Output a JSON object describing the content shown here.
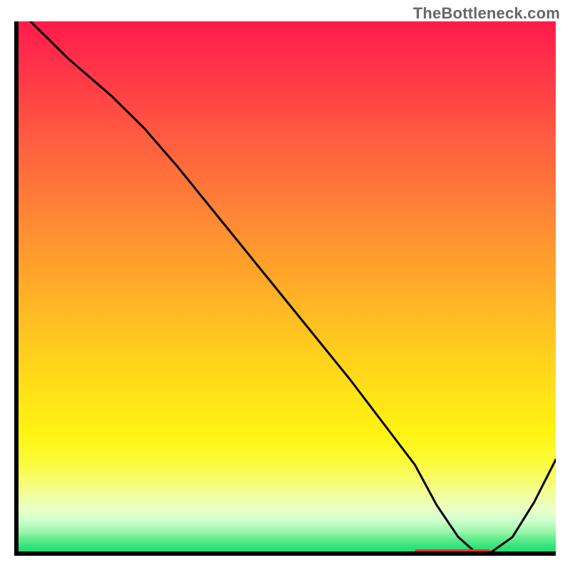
{
  "watermark": "TheBottleneck.com",
  "chart_data": {
    "type": "line",
    "title": "",
    "xlabel": "",
    "ylabel": "",
    "xlim": [
      0,
      100
    ],
    "ylim": [
      0,
      100
    ],
    "grid": false,
    "legend": false,
    "background_gradient": {
      "top": "#ff1b4a",
      "mid": "#ffd11c",
      "bottom": "#16da70"
    },
    "series": [
      {
        "name": "bottleneck-curve",
        "color": "#000000",
        "x": [
          3,
          10,
          18,
          24,
          30,
          38,
          46,
          54,
          62,
          68,
          74,
          78,
          82,
          85,
          88,
          92,
          96,
          100
        ],
        "y": [
          100,
          93,
          86,
          80,
          73,
          63,
          53,
          43,
          33,
          25,
          17,
          9.5,
          3.5,
          0.8,
          0.6,
          3.5,
          10,
          18
        ]
      }
    ],
    "annotations": [
      {
        "name": "optimum-range-marker",
        "type": "bar-segment",
        "color": "#e9323f",
        "x_start": 74,
        "x_end": 88,
        "y": 0.6
      }
    ]
  },
  "colors": {
    "watermark": "#666666",
    "axis": "#000000",
    "curve": "#000000",
    "marker": "#e9323f"
  }
}
